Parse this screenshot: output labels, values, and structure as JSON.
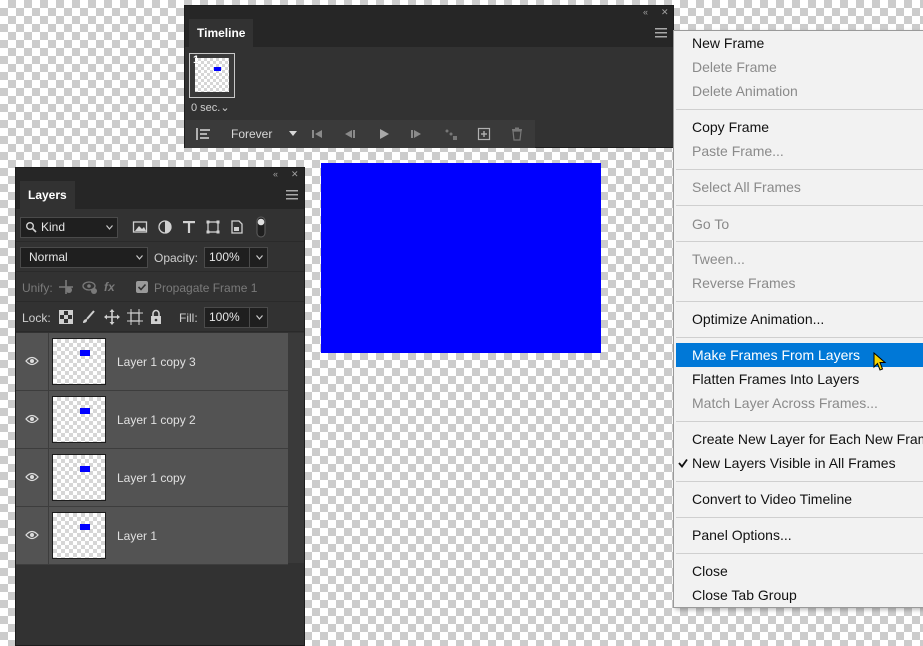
{
  "colors": {
    "panel_bg": "#323232",
    "panel_header": "#262626",
    "layer_row": "#535353",
    "canvas_shape": "#0000ff",
    "menu_bg": "#f2f2f2",
    "menu_highlight": "#0078d7",
    "menu_text": "#111111",
    "menu_disabled": "#8a8a8a"
  },
  "timeline": {
    "tab_title": "Timeline",
    "frame": {
      "number": "1",
      "delay": "0 sec.⌄"
    },
    "loop": "Forever",
    "toolbar_icons": [
      "convert-to-video-icon",
      "first-frame-icon",
      "previous-frame-icon",
      "play-icon",
      "next-frame-icon",
      "tween-icon",
      "duplicate-frame-icon",
      "delete-frame-icon"
    ]
  },
  "layers": {
    "tab_title": "Layers",
    "filter_kind": "Kind",
    "filter_icons": [
      "image-filter-icon",
      "adjustment-filter-icon",
      "type-filter-icon",
      "shape-filter-icon",
      "smart-object-filter-icon",
      "filter-toggle-icon"
    ],
    "blend_mode": "Normal",
    "opacity_label": "Opacity:",
    "opacity_value": "100%",
    "unify_label": "Unify:",
    "propagate_label": "Propagate Frame 1",
    "lock_label": "Lock:",
    "fill_label": "Fill:",
    "fill_value": "100%",
    "items": [
      {
        "name": "Layer 1 copy 3",
        "visible": true
      },
      {
        "name": "Layer 1 copy 2",
        "visible": true
      },
      {
        "name": "Layer 1 copy",
        "visible": true
      },
      {
        "name": "Layer 1",
        "visible": true
      }
    ]
  },
  "context_menu": {
    "items": {
      "new_frame": {
        "label": "New Frame",
        "enabled": true
      },
      "delete_frame": {
        "label": "Delete Frame",
        "enabled": false
      },
      "delete_animation": {
        "label": "Delete Animation",
        "enabled": false
      },
      "copy_frame": {
        "label": "Copy Frame",
        "enabled": true
      },
      "paste_frame": {
        "label": "Paste Frame...",
        "enabled": false
      },
      "select_all_frames": {
        "label": "Select All Frames",
        "enabled": false
      },
      "go_to": {
        "label": "Go To",
        "enabled": false
      },
      "tween": {
        "label": "Tween...",
        "enabled": false
      },
      "reverse_frames": {
        "label": "Reverse Frames",
        "enabled": false
      },
      "optimize_animation": {
        "label": "Optimize Animation...",
        "enabled": true
      },
      "make_frames_from_layers": {
        "label": "Make Frames From Layers",
        "enabled": true,
        "highlighted": true
      },
      "flatten_frames": {
        "label": "Flatten Frames Into Layers",
        "enabled": true
      },
      "match_layer": {
        "label": "Match Layer Across Frames...",
        "enabled": false
      },
      "create_new_layer": {
        "label": "Create New Layer for Each New Frame",
        "enabled": true
      },
      "new_layers_visible": {
        "label": "New Layers Visible in All Frames",
        "enabled": true,
        "checked": true
      },
      "convert_to_video": {
        "label": "Convert to Video Timeline",
        "enabled": true
      },
      "panel_options": {
        "label": "Panel Options...",
        "enabled": true
      },
      "close": {
        "label": "Close",
        "enabled": true
      },
      "close_tab_group": {
        "label": "Close Tab Group",
        "enabled": true
      }
    }
  }
}
